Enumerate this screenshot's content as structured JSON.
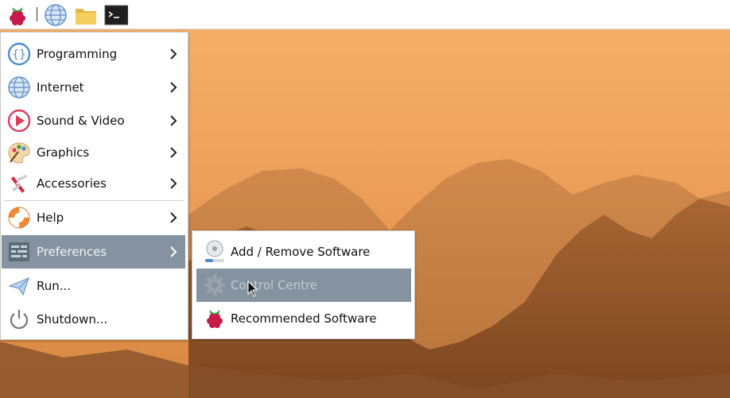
{
  "taskbar": {
    "launchers": [
      {
        "icon": "raspberry-pi-menu-icon"
      },
      {
        "icon": "web-browser-icon"
      },
      {
        "icon": "file-manager-icon"
      },
      {
        "icon": "terminal-icon",
        "glyph": ">_"
      }
    ]
  },
  "main_menu": {
    "items": [
      {
        "label": "Programming",
        "icon": "programming-icon",
        "submenu": true
      },
      {
        "label": "Internet",
        "icon": "internet-globe-icon",
        "submenu": true
      },
      {
        "label": "Sound & Video",
        "icon": "sound-video-icon",
        "submenu": true
      },
      {
        "label": "Graphics",
        "icon": "graphics-palette-icon",
        "submenu": true
      },
      {
        "label": "Accessories",
        "icon": "accessories-knife-icon",
        "submenu": true
      },
      {
        "label": "Help",
        "icon": "help-lifebuoy-icon",
        "submenu": true
      },
      {
        "label": "Preferences",
        "icon": "preferences-icon",
        "submenu": true,
        "active": true
      },
      {
        "label": "Run...",
        "icon": "run-paper-plane-icon",
        "submenu": false
      },
      {
        "label": "Shutdown...",
        "icon": "power-icon",
        "submenu": false
      }
    ]
  },
  "preferences_submenu": {
    "items": [
      {
        "label": "Add / Remove Software",
        "icon": "add-remove-software-icon"
      },
      {
        "label": "Control Centre",
        "icon": "gear-icon",
        "active": true
      },
      {
        "label": "Recommended Software",
        "icon": "raspberry-pi-icon"
      }
    ]
  },
  "colors": {
    "menu_highlight": "#8593a0",
    "sky_top": "#f0a455",
    "mountains": "#9b5a2c"
  }
}
